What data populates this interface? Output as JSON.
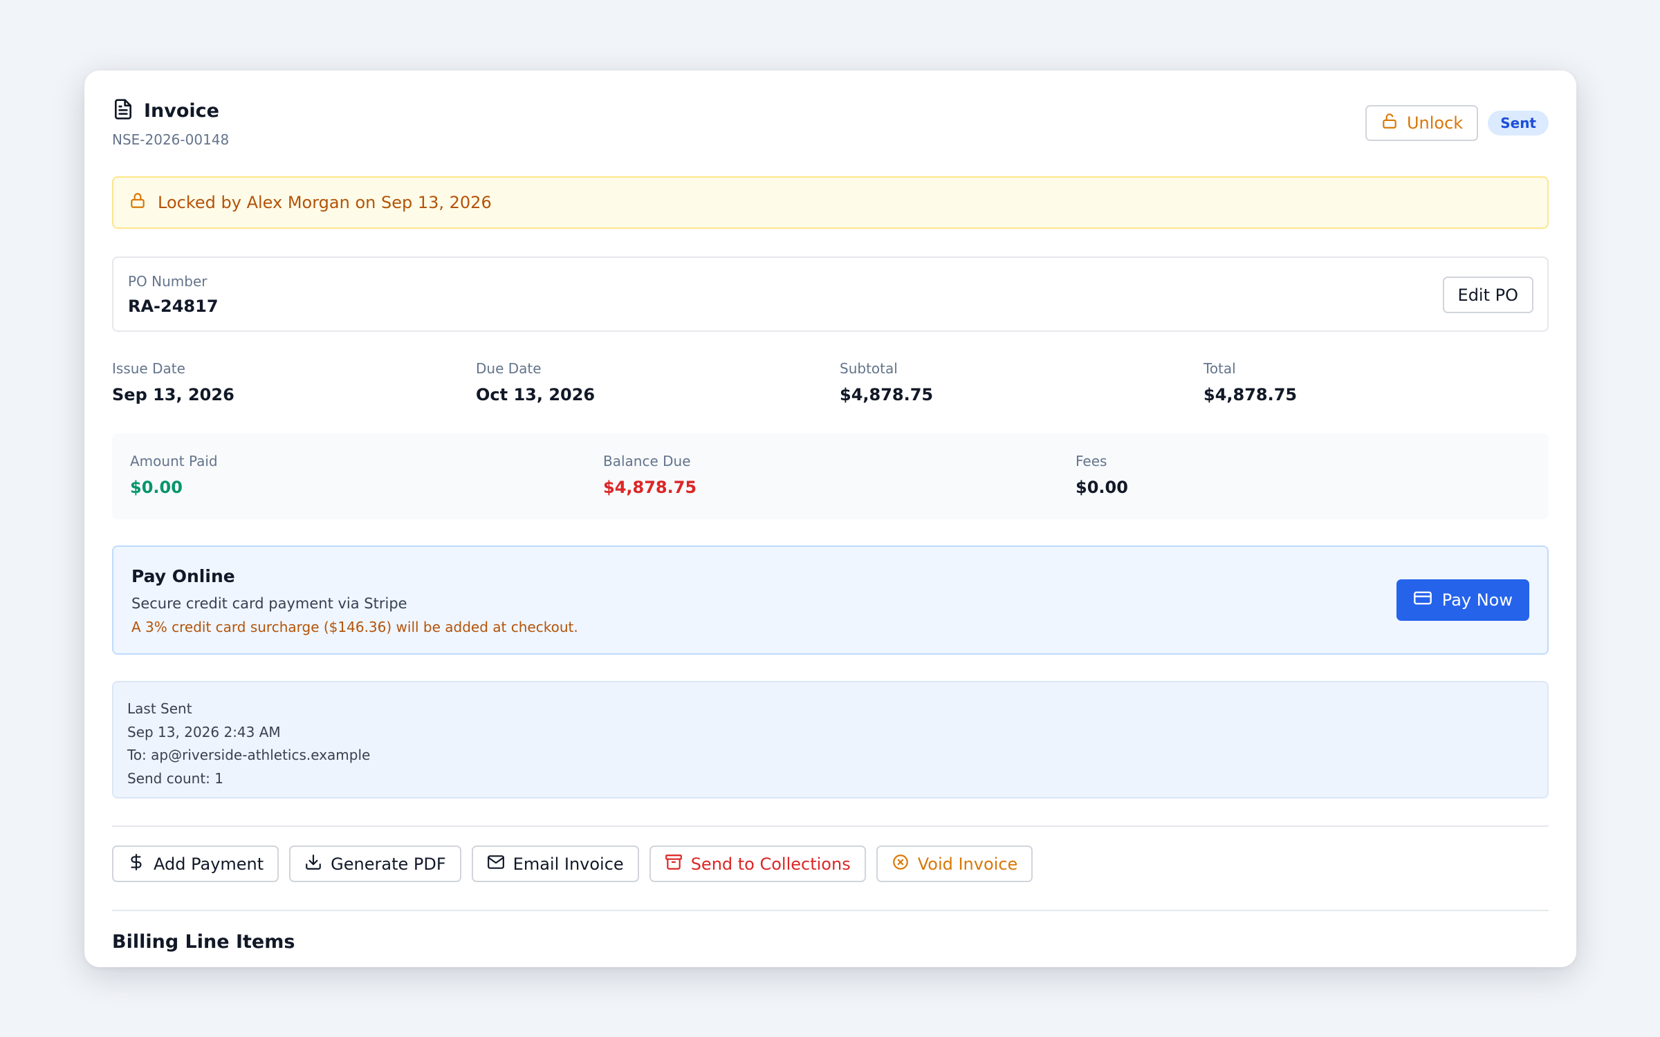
{
  "header": {
    "title": "Invoice",
    "title_icon": "document-icon",
    "invoice_number": "NSE-2026-00148",
    "unlock_label": "Unlock",
    "status_badge": "Sent"
  },
  "lock_banner": {
    "text": "Locked by Alex Morgan on Sep 13, 2026"
  },
  "po": {
    "label": "PO Number",
    "value": "RA-24817",
    "edit_label": "Edit PO"
  },
  "stats": [
    {
      "label": "Issue Date",
      "value": "Sep 13, 2026"
    },
    {
      "label": "Due Date",
      "value": "Oct 13, 2026"
    },
    {
      "label": "Subtotal",
      "value": "$4,878.75"
    },
    {
      "label": "Total",
      "value": "$4,878.75"
    }
  ],
  "payment_summary": [
    {
      "label": "Amount Paid",
      "value": "$0.00"
    },
    {
      "label": "Balance Due",
      "value": "$4,878.75"
    },
    {
      "label": "Fees",
      "value": "$0.00"
    }
  ],
  "pay_online": {
    "title": "Pay Online",
    "description": "Secure credit card payment via Stripe",
    "surcharge_note": "A 3% credit card surcharge ($146.36) will be added at checkout.",
    "button_label": "Pay Now"
  },
  "last_sent": {
    "label": "Last Sent",
    "datetime": "Sep 13, 2026 2:43 AM",
    "recipient": "To: ap@riverside-athletics.example",
    "send_count": "Send count: 1"
  },
  "actions": [
    {
      "label": "Add Payment",
      "icon": "dollar-icon"
    },
    {
      "label": "Generate PDF",
      "icon": "download-icon"
    },
    {
      "label": "Email Invoice",
      "icon": "mail-icon"
    },
    {
      "label": "Send to Collections",
      "icon": "archive-icon"
    },
    {
      "label": "Void Invoice",
      "icon": "x-circle-icon"
    }
  ],
  "section_title": "Billing Line Items",
  "colors": {
    "accent": "#2563eb",
    "success": "#059669",
    "danger": "#dc2626",
    "warning": "#d97706",
    "badge_bg": "#dbeafe"
  }
}
